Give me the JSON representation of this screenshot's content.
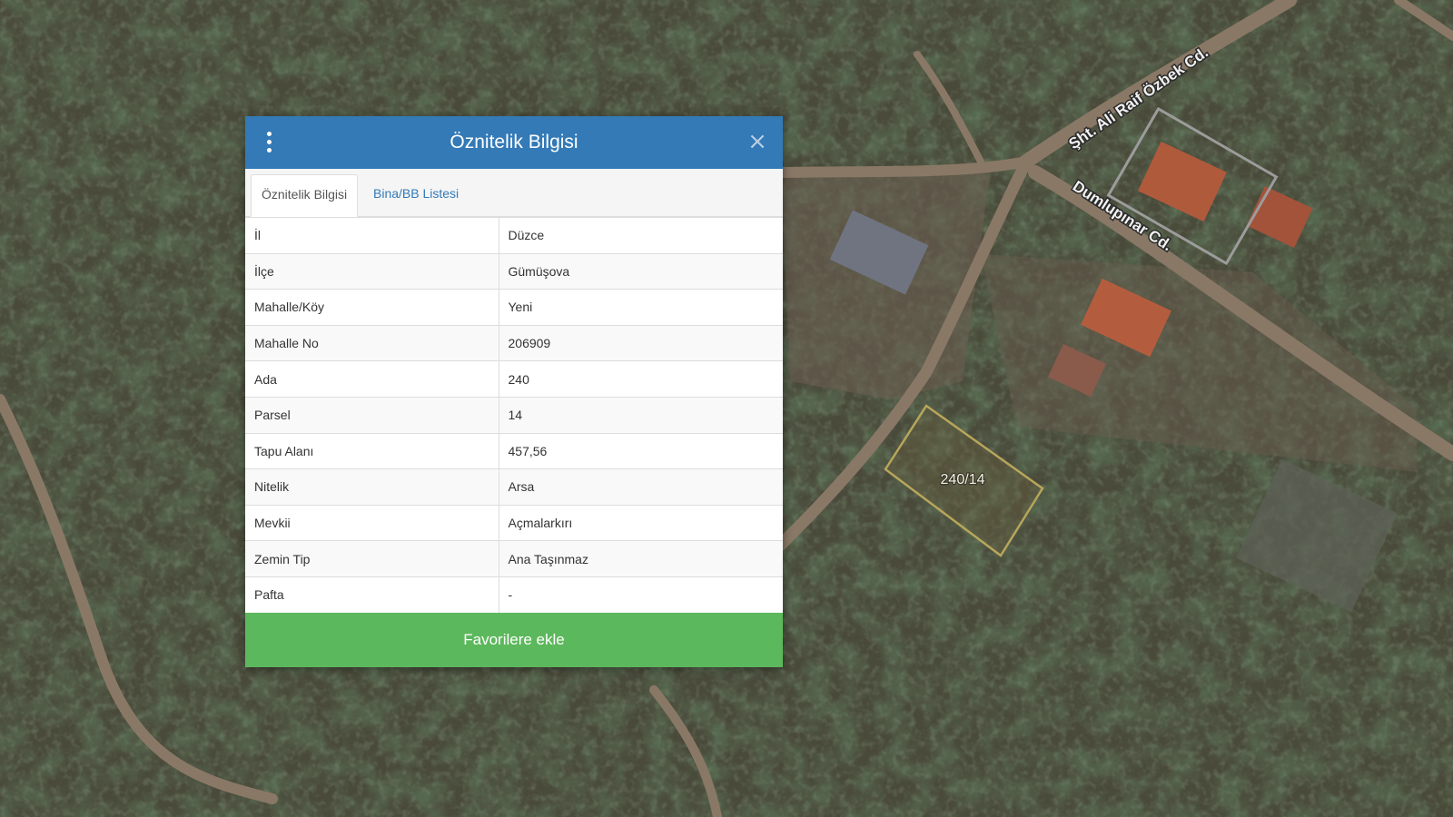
{
  "dialog": {
    "title": "Öznitelik Bilgisi",
    "tabs": [
      {
        "label": "Öznitelik Bilgisi",
        "active": true
      },
      {
        "label": "Bina/BB Listesi",
        "active": false
      }
    ],
    "rows": [
      {
        "key": "İl",
        "value": "Düzce"
      },
      {
        "key": "İlçe",
        "value": "Gümüşova"
      },
      {
        "key": "Mahalle/Köy",
        "value": "Yeni"
      },
      {
        "key": "Mahalle No",
        "value": "206909"
      },
      {
        "key": "Ada",
        "value": "240"
      },
      {
        "key": "Parsel",
        "value": "14"
      },
      {
        "key": "Tapu Alanı",
        "value": "457,56"
      },
      {
        "key": "Nitelik",
        "value": "Arsa"
      },
      {
        "key": "Mevkii",
        "value": "Açmalarkırı"
      },
      {
        "key": "Zemin Tip",
        "value": "Ana Taşınmaz"
      },
      {
        "key": "Pafta",
        "value": "-"
      }
    ],
    "favorite_button": "Favorilere ekle",
    "menu_icon": "kebab-menu-icon",
    "close_icon": "close-icon",
    "header_color": "#337ab7",
    "button_color": "#5cb85c"
  },
  "map": {
    "roads": [
      {
        "label": "Şht. Ali Raif Özbek Cd."
      },
      {
        "label": "Dumlupınar Cd."
      }
    ],
    "parcel_label": "240/14",
    "parcel_outline_color": "#b7a65a"
  }
}
